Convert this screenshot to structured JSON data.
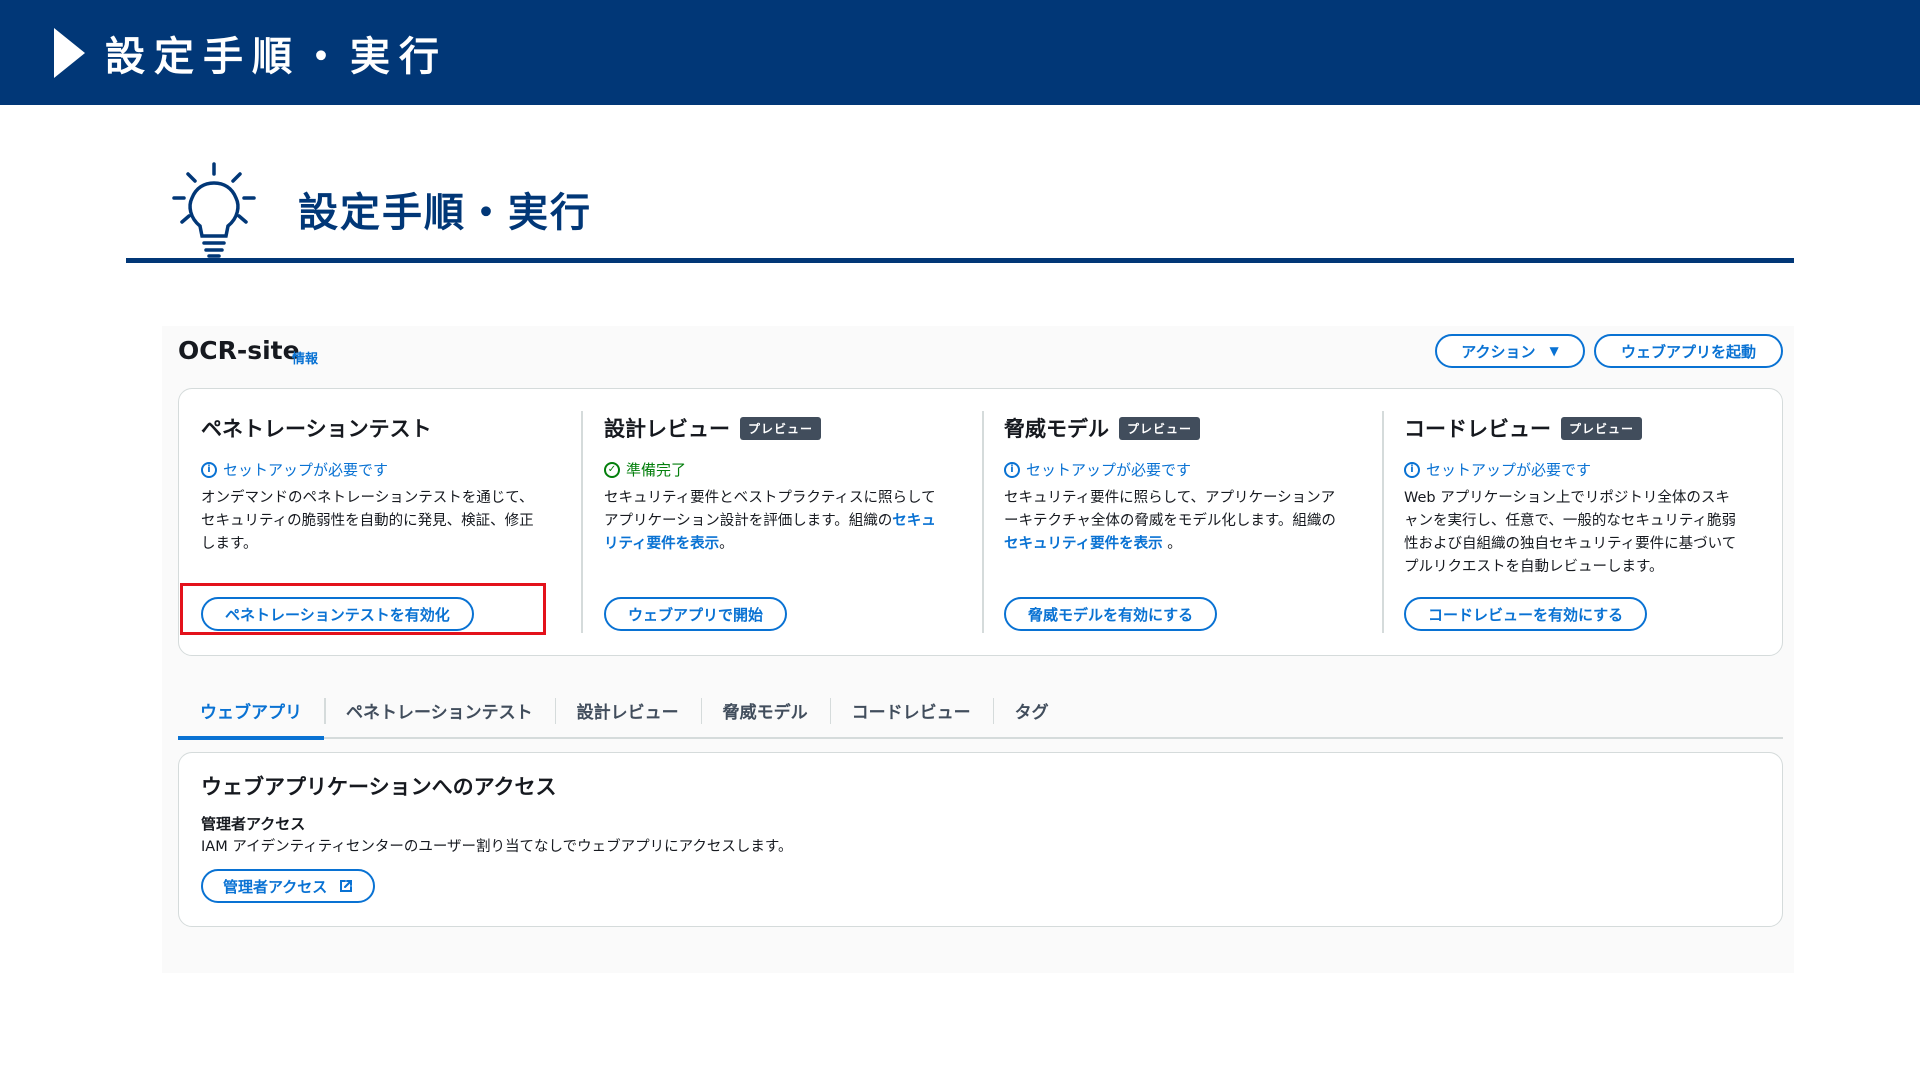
{
  "banner": {
    "title": "設定手順・実行"
  },
  "section": {
    "title": "設定手順・実行",
    "icon": "lightbulb-icon"
  },
  "console": {
    "app_name": "OCR-site",
    "info_link": "情報",
    "actions_label": "アクション",
    "launch_label": "ウェブアプリを起動",
    "cards": [
      {
        "title": "ペネトレーションテスト",
        "badge": "",
        "status": "セットアップが必要です",
        "desc": "オンデマンドのペネトレーションテストを通じて、セキュリティの脆弱性を自動的に発見、検証、修正します。",
        "button": "ペネトレーションテストを有効化"
      },
      {
        "title": "設計レビュー",
        "badge": "プレビュー",
        "status": "準備完了",
        "desc_prefix": "セキュリティ要件とベストプラクティスに照らしてアプリケーション設計を評価します。組織の",
        "desc_link": "セキュリティ要件を表示",
        "desc_suffix": "。",
        "button": "ウェブアプリで開始"
      },
      {
        "title": "脅威モデル",
        "badge": "プレビュー",
        "status": "セットアップが必要です",
        "desc_prefix": "セキュリティ要件に照らして、アプリケーションアーキテクチャ全体の脅威をモデル化します。組織の ",
        "desc_link": "セキュリティ要件を表示",
        "desc_suffix": " 。",
        "button": "脅威モデルを有効にする"
      },
      {
        "title": "コードレビュー",
        "badge": "プレビュー",
        "status": "セットアップが必要です",
        "desc": "Web アプリケーション上でリポジトリ全体のスキャンを実行し、任意で、一般的なセキュリティ脆弱性および自組織の独自セキュリティ要件に基づいてプルリクエストを自動レビューします。",
        "button": "コードレビューを有効にする"
      }
    ],
    "tabs": [
      "ウェブアプリ",
      "ペネトレーションテスト",
      "設計レビュー",
      "脅威モデル",
      "コードレビュー",
      "タグ"
    ],
    "active_tab": "ウェブアプリ",
    "access": {
      "title": "ウェブアプリケーションへのアクセス",
      "subtitle": "管理者アクセス",
      "desc": "IAM アイデンティティセンターのユーザー割り当てなしでウェブアプリにアクセスします。",
      "button": "管理者アクセス"
    }
  },
  "colors": {
    "brand_navy": "#013777",
    "link_blue": "#0972d3",
    "ok_green": "#037f0c",
    "highlight_red": "#e3111b",
    "badge_gray": "#414d5c"
  }
}
